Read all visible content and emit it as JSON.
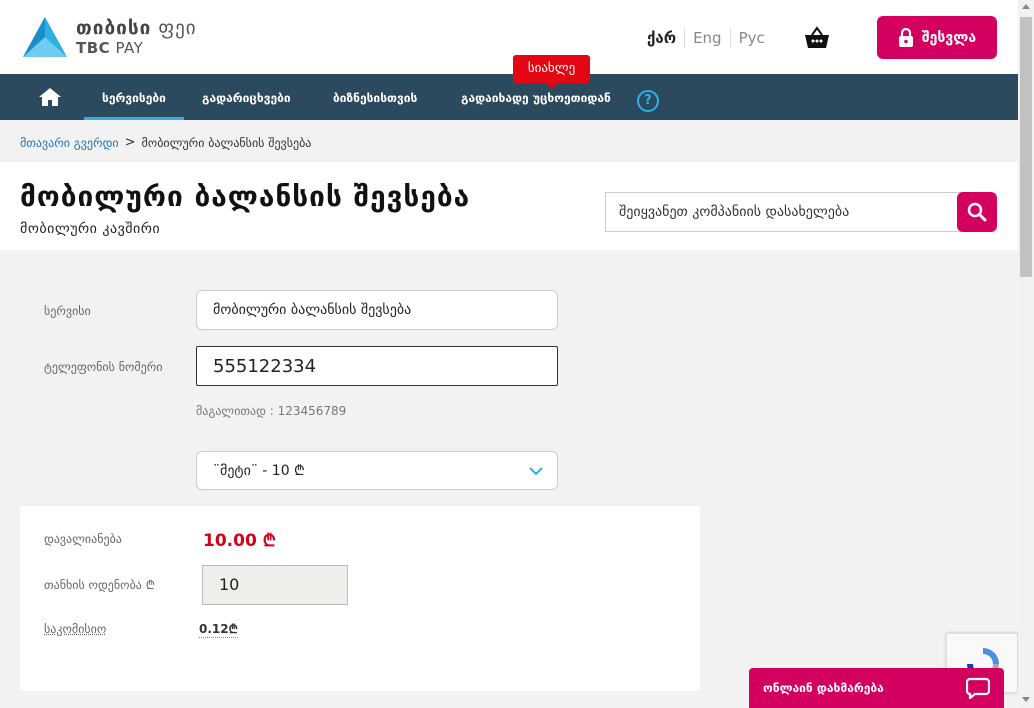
{
  "header": {
    "logo_ka": "თიბისი",
    "logo_ka_suffix": "ფეი",
    "logo_en": "TBC",
    "logo_en_suffix": "PAY",
    "languages": [
      "ქარ",
      "Eng",
      "Рус"
    ],
    "login_label": "შესვლა",
    "basket_icon": "basket-icon"
  },
  "nav": {
    "items": [
      "სერვისები",
      "გადარიცხვები",
      "ბიზნესისთვის",
      "გადაიხადე უცხოეთიდან"
    ],
    "help": "?",
    "new_badge": "სიახლე"
  },
  "breadcrumb": {
    "home": "მთავარი გვერდი",
    "separator": ">",
    "current": "მობილური ბალანსის შევსება"
  },
  "page": {
    "title": "მობილური ბალანსის შევსება",
    "subtitle": "მობილური კავშირი",
    "search_placeholder": "შეიყვანეთ კომპანიის დასახელება"
  },
  "form": {
    "service_label": "სერვისი",
    "service_value": "მობილური ბალანსის შევსება",
    "phone_label": "ტელეფონის ნომერი",
    "phone_value": "555122334",
    "hint": "მაგალითად : 123456789",
    "plan_value": "¨მეტი¨ - 10 ₾"
  },
  "payment": {
    "debt_label": "დავალიანება",
    "debt_value": "10.00 ₾",
    "amount_label": "თანხის ოდენობა ₾",
    "amount_value": "10",
    "commission_label": "საკომისიო",
    "commission_value": "0.12₾"
  },
  "chat": {
    "label": "ონლაინ დახმარება"
  },
  "colors": {
    "brand": "#d4005f",
    "nav": "#2c4a5e",
    "accent": "#2eb0e4",
    "debt": "#d0021b"
  }
}
